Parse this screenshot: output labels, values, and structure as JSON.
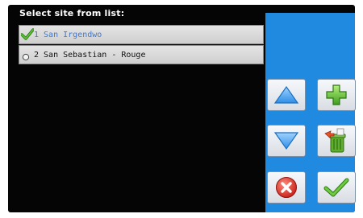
{
  "title": "Select site from list:",
  "sites": [
    {
      "label": "1 San Irgendwo",
      "selected": true,
      "mark_icon": "check-icon"
    },
    {
      "label": "2 San Sebastian - Rouge",
      "selected": false,
      "mark_icon": "radio-icon"
    }
  ],
  "buttons": {
    "up": {
      "icon": "arrow-up-icon"
    },
    "add": {
      "icon": "plus-icon"
    },
    "down": {
      "icon": "arrow-down-icon"
    },
    "delete": {
      "icon": "trash-icon"
    },
    "cancel": {
      "icon": "close-icon"
    },
    "confirm": {
      "icon": "check-icon"
    }
  },
  "colors": {
    "panel": "#1f8ae0",
    "selected_text": "#3b78d8",
    "check_green": "#4caa2b",
    "cancel_red": "#d93228"
  }
}
